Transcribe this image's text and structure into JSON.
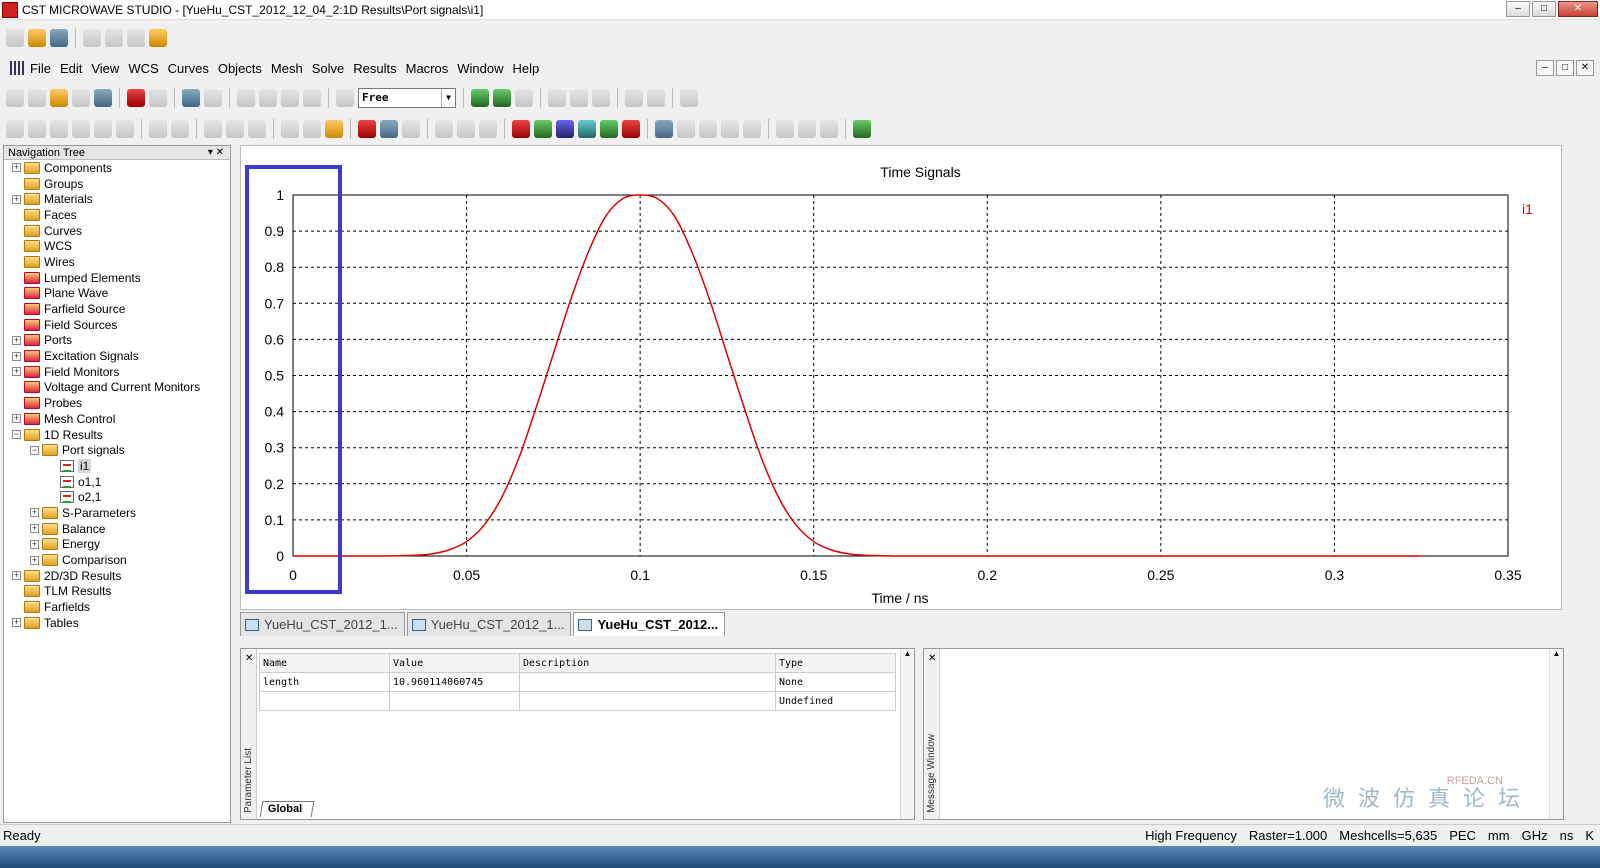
{
  "window": {
    "title": "CST MICROWAVE STUDIO - [YueHu_CST_2012_12_04_2:1D Results\\Port signals\\i1]",
    "controls": [
      "–",
      "□",
      "✕"
    ]
  },
  "menu": {
    "items": [
      "File",
      "Edit",
      "View",
      "WCS",
      "Curves",
      "Objects",
      "Mesh",
      "Solve",
      "Results",
      "Macros",
      "Window",
      "Help"
    ],
    "mdi_controls": [
      "–",
      "□",
      "✕"
    ]
  },
  "toolbar": {
    "mode_combo": "Free"
  },
  "nav_tree": {
    "header": "Navigation Tree",
    "items": [
      {
        "label": "Components",
        "depth": 0,
        "expandable": true,
        "icon": "folder"
      },
      {
        "label": "Groups",
        "depth": 0,
        "expandable": false,
        "icon": "folder"
      },
      {
        "label": "Materials",
        "depth": 0,
        "expandable": true,
        "icon": "folder"
      },
      {
        "label": "Faces",
        "depth": 0,
        "expandable": false,
        "icon": "folder"
      },
      {
        "label": "Curves",
        "depth": 0,
        "expandable": false,
        "icon": "folder"
      },
      {
        "label": "WCS",
        "depth": 0,
        "expandable": false,
        "icon": "folder"
      },
      {
        "label": "Wires",
        "depth": 0,
        "expandable": false,
        "icon": "folder"
      },
      {
        "label": "Lumped Elements",
        "depth": 0,
        "expandable": false,
        "icon": "folder-red"
      },
      {
        "label": "Plane Wave",
        "depth": 0,
        "expandable": false,
        "icon": "folder-red"
      },
      {
        "label": "Farfield Source",
        "depth": 0,
        "expandable": false,
        "icon": "folder-red"
      },
      {
        "label": "Field Sources",
        "depth": 0,
        "expandable": false,
        "icon": "folder-red"
      },
      {
        "label": "Ports",
        "depth": 0,
        "expandable": true,
        "icon": "folder-red"
      },
      {
        "label": "Excitation Signals",
        "depth": 0,
        "expandable": true,
        "icon": "folder-red"
      },
      {
        "label": "Field Monitors",
        "depth": 0,
        "expandable": true,
        "icon": "folder-red"
      },
      {
        "label": "Voltage and Current Monitors",
        "depth": 0,
        "expandable": false,
        "icon": "folder-red"
      },
      {
        "label": "Probes",
        "depth": 0,
        "expandable": false,
        "icon": "folder-red"
      },
      {
        "label": "Mesh Control",
        "depth": 0,
        "expandable": true,
        "icon": "folder-red"
      },
      {
        "label": "1D Results",
        "depth": 0,
        "expandable": true,
        "expanded": true,
        "icon": "folder"
      },
      {
        "label": "Port signals",
        "depth": 1,
        "expandable": true,
        "expanded": true,
        "icon": "folder"
      },
      {
        "label": "i1",
        "depth": 2,
        "expandable": false,
        "icon": "signal",
        "selected": true
      },
      {
        "label": "o1,1",
        "depth": 2,
        "expandable": false,
        "icon": "signal"
      },
      {
        "label": "o2,1",
        "depth": 2,
        "expandable": false,
        "icon": "signal"
      },
      {
        "label": "S-Parameters",
        "depth": 1,
        "expandable": true,
        "icon": "folder"
      },
      {
        "label": "Balance",
        "depth": 1,
        "expandable": true,
        "icon": "folder"
      },
      {
        "label": "Energy",
        "depth": 1,
        "expandable": true,
        "icon": "folder"
      },
      {
        "label": "Comparison",
        "depth": 1,
        "expandable": true,
        "icon": "folder"
      },
      {
        "label": "2D/3D Results",
        "depth": 0,
        "expandable": true,
        "icon": "folder"
      },
      {
        "label": "TLM Results",
        "depth": 0,
        "expandable": false,
        "icon": "folder"
      },
      {
        "label": "Farfields",
        "depth": 0,
        "expandable": false,
        "icon": "folder"
      },
      {
        "label": "Tables",
        "depth": 0,
        "expandable": true,
        "icon": "folder"
      }
    ]
  },
  "chart_data": {
    "type": "line",
    "title": "Time Signals",
    "xlabel": "Time / ns",
    "ylabel": "",
    "xlim": [
      0,
      0.35
    ],
    "ylim": [
      0,
      1
    ],
    "xticks": [
      "0",
      "0.05",
      "0.1",
      "0.15",
      "0.2",
      "0.25",
      "0.3",
      "0.35"
    ],
    "yticks": [
      "0",
      "0.1",
      "0.2",
      "0.3",
      "0.4",
      "0.5",
      "0.6",
      "0.7",
      "0.8",
      "0.9",
      "1"
    ],
    "grid": true,
    "legend_position": "top-right",
    "series": [
      {
        "name": "i1",
        "color": "#e00000",
        "x": [
          0,
          0.025,
          0.035,
          0.04,
          0.045,
          0.05,
          0.055,
          0.06,
          0.065,
          0.07,
          0.075,
          0.08,
          0.085,
          0.09,
          0.095,
          0.1,
          0.105,
          0.11,
          0.115,
          0.12,
          0.125,
          0.13,
          0.135,
          0.14,
          0.145,
          0.15,
          0.155,
          0.16,
          0.165,
          0.175,
          0.2,
          0.25,
          0.3,
          0.325
        ],
        "y": [
          0,
          0,
          0.002,
          0.006,
          0.017,
          0.04,
          0.085,
          0.16,
          0.27,
          0.41,
          0.56,
          0.71,
          0.84,
          0.94,
          0.99,
          1,
          0.99,
          0.94,
          0.84,
          0.71,
          0.56,
          0.41,
          0.27,
          0.16,
          0.085,
          0.04,
          0.017,
          0.006,
          0.002,
          0,
          0,
          0,
          0,
          0
        ]
      }
    ]
  },
  "doc_tabs": [
    {
      "label": "YueHu_CST_2012_1...",
      "active": false
    },
    {
      "label": "YueHu_CST_2012_1...",
      "active": false
    },
    {
      "label": "YueHu_CST_2012...",
      "active": true
    }
  ],
  "param_list": {
    "side_label": "Parameter List",
    "columns": [
      "Name",
      "Value",
      "Description",
      "Type"
    ],
    "rows": [
      [
        "length",
        "10.960114060745",
        "",
        "None"
      ],
      [
        "",
        "",
        "",
        "Undefined"
      ]
    ],
    "tab": "Global"
  },
  "message_window": {
    "side_label": "Message Window",
    "watermark": "微 波 仿 真 论 坛",
    "watermark_en": "RFEDA.CN"
  },
  "status": {
    "left": "Ready",
    "right": [
      "High Frequency",
      "Raster=1.000",
      "Meshcells=5,635",
      "PEC",
      "mm",
      "GHz",
      "ns",
      "K"
    ]
  }
}
